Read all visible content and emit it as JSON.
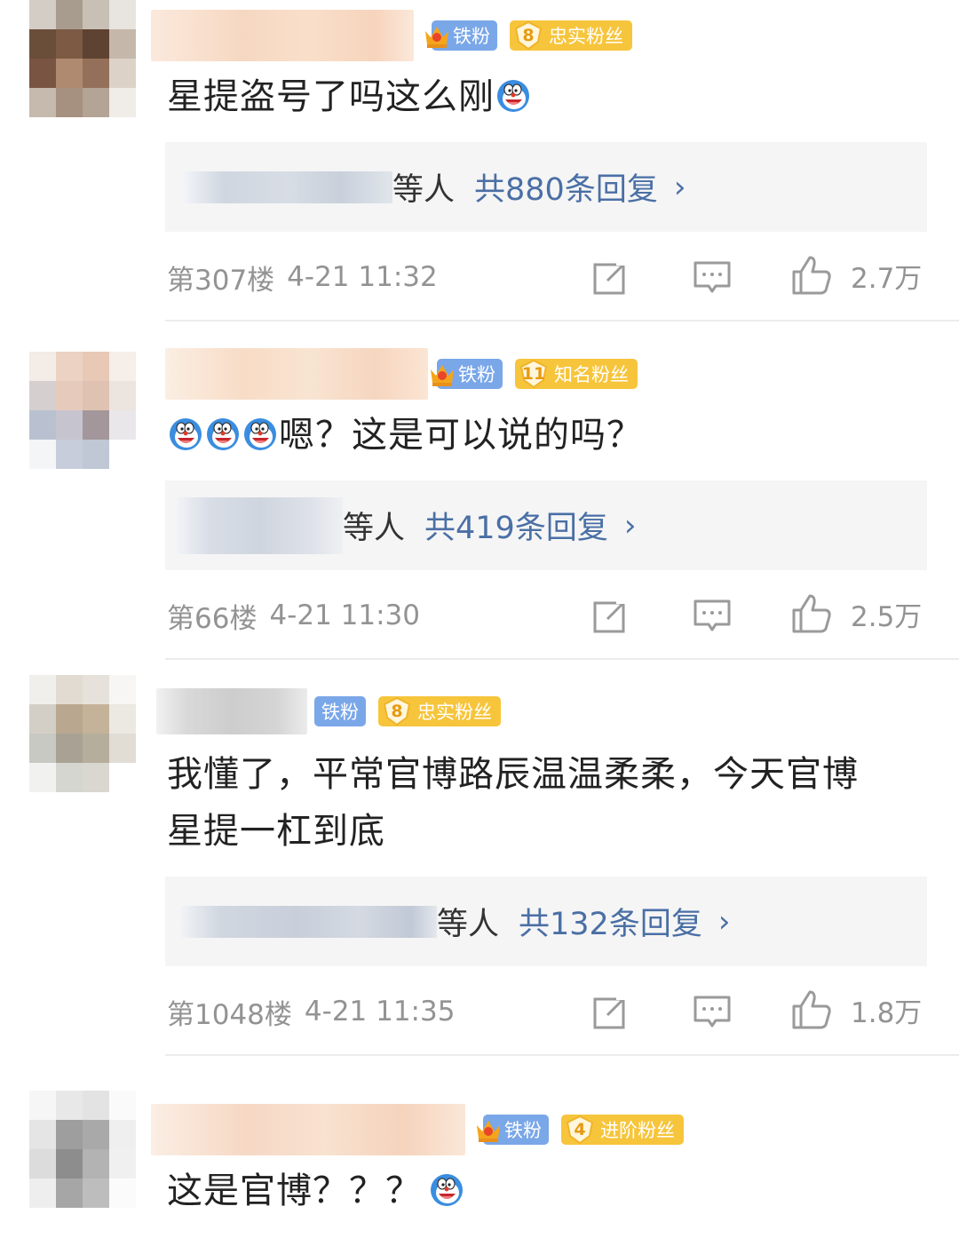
{
  "comments": [
    {
      "badge_iron": "铁粉",
      "fan_level": "8",
      "fan_label": "忠实粉丝",
      "fan_color": "#f7c53c",
      "text": "星提盗号了吗这么刚",
      "reply_who": "等人",
      "reply_count": "共880条回复",
      "floor": "第307楼",
      "time": "4-21 11:32",
      "likes": "2.7万"
    },
    {
      "badge_iron": "铁粉",
      "fan_level": "11",
      "fan_label": "知名粉丝",
      "fan_color": "#f7c53c",
      "text": "嗯？这是可以说的吗？",
      "reply_who": "等人",
      "reply_count": "共419条回复",
      "floor": "第66楼",
      "time": "4-21 11:30",
      "likes": "2.5万"
    },
    {
      "badge_iron": "铁粉",
      "fan_level": "8",
      "fan_label": "忠实粉丝",
      "fan_color": "#f7c53c",
      "text_line1": "我懂了，平常官博路辰温温柔柔，今天官博",
      "text_line2": "星提一杠到底",
      "reply_who": "等人",
      "reply_count": "共132条回复",
      "floor": "第1048楼",
      "time": "4-21 11:35",
      "likes": "1.8万"
    },
    {
      "badge_iron": "铁粉",
      "fan_level": "4",
      "fan_label": "进阶粉丝",
      "fan_color": "#f7c53c",
      "text": "这是官博？？？"
    }
  ],
  "icons": {
    "chevron": "›",
    "emoji": "doraemon-laugh-emoji",
    "repost": "repost-icon",
    "comment": "comment-icon",
    "like": "thumbs-up-icon"
  }
}
